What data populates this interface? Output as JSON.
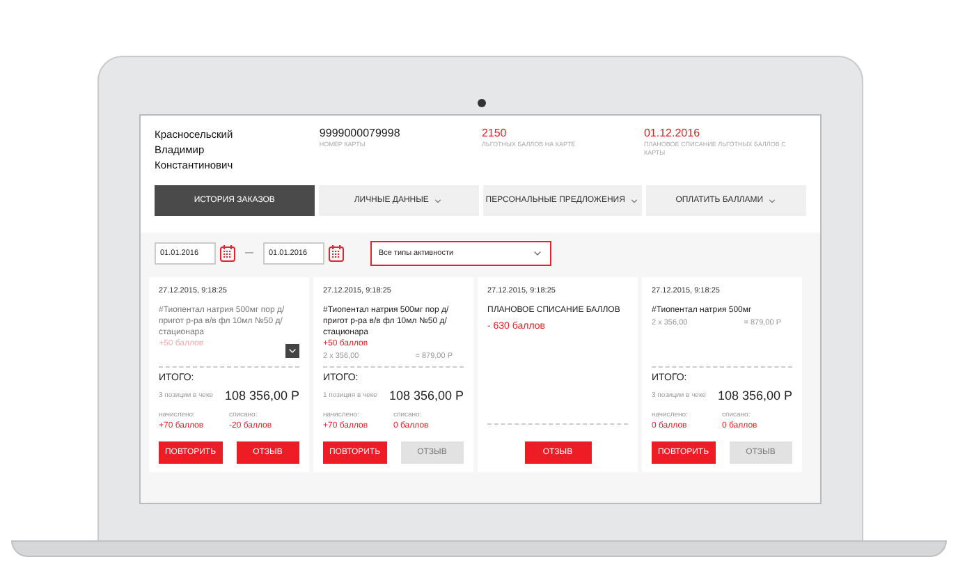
{
  "customer": {
    "name_lines": [
      "Красносельский",
      "Владимир",
      "Константинович"
    ]
  },
  "stats": [
    {
      "value": "9999000079998",
      "label": "НОМЕР КАРТЫ",
      "accent": false
    },
    {
      "value": "2150",
      "label": "ЛЬГОТНЫХ БАЛЛОВ НА КАРТЕ",
      "accent": true
    },
    {
      "value": "01.12.2016",
      "label": "ПЛАНОВОЕ СПИСАНИЕ ЛЬГОТНЫХ БАЛЛОВ С КАРТЫ",
      "accent": true
    }
  ],
  "tabs": [
    {
      "label": "ИСТОРИЯ ЗАКАЗОВ",
      "selected": true,
      "dropdown": false
    },
    {
      "label": "ЛИЧНЫЕ ДАННЫЕ",
      "selected": false,
      "dropdown": true
    },
    {
      "label": "ПЕРСОНАЛЬНЫЕ ПРЕДЛОЖЕНИЯ",
      "selected": false,
      "dropdown": true
    },
    {
      "label": "ОПЛАТИТЬ БАЛЛАМИ",
      "selected": false,
      "dropdown": true
    }
  ],
  "filter": {
    "date_from": "01.01.2016",
    "separator": "—",
    "date_to": "01.01.2016",
    "activity": "Все типы активности"
  },
  "orders": [
    {
      "kind": "order",
      "datetime": "27.12.2015, 9:18:25",
      "collapsed": true,
      "items": [
        {
          "name": "#Тиопентал натрия 500мг пор д/пригот р-ра в/в фл 10мл №50 д/стационара",
          "points": "+50 баллов"
        }
      ],
      "total_label": "ИТОГО:",
      "positions": "3 позиции в чеке",
      "total": "108 356,00 Р",
      "accrued_label": "начислено:",
      "accrued": "+70 баллов",
      "written_label": "списано:",
      "written": "-20 баллов",
      "buttons": [
        {
          "label": "ПОВТОРИТЬ",
          "disabled": false
        },
        {
          "label": "ОТЗЫВ",
          "disabled": false
        }
      ]
    },
    {
      "kind": "order",
      "datetime": "27.12.2015, 9:18:25",
      "collapsed": false,
      "items": [
        {
          "name": "#Тиопентал натрия 500мг пор д/пригот р-ра в/в фл 10мл №50 д/стационара",
          "points": "+50 баллов",
          "qty": "2 х 356,00",
          "sum": "= 879,00 Р"
        }
      ],
      "total_label": "ИТОГО:",
      "positions": "1 позиция в чеке",
      "total": "108 356,00 Р",
      "accrued_label": "начислено:",
      "accrued": "+70 баллов",
      "written_label": "списано:",
      "written": "0 баллов",
      "buttons": [
        {
          "label": "ПОВТОРИТЬ",
          "disabled": false
        },
        {
          "label": "ОТЗЫВ",
          "disabled": true
        }
      ]
    },
    {
      "kind": "writeoff",
      "datetime": "27.12.2015, 9:18:25",
      "title": "ПЛАНОВОЕ СПИСАНИЕ БАЛЛОВ",
      "amount": "- 630 баллов",
      "buttons": [
        {
          "label": "ОТЗЫВ",
          "disabled": false
        }
      ]
    },
    {
      "kind": "order",
      "datetime": "27.12.2015, 9:18:25",
      "collapsed": false,
      "items": [
        {
          "name": "#Тиопентал натрия 500мг",
          "qty": "2 х 356,00",
          "sum": "= 879,00 Р"
        }
      ],
      "total_label": "ИТОГО:",
      "positions": "3 позиции в чеке",
      "total": "108 356,00 Р",
      "accrued_label": "начислено:",
      "accrued": "0 баллов",
      "written_label": "списано:",
      "written": "0 баллов",
      "buttons": [
        {
          "label": "ПОВТОРИТЬ",
          "disabled": false
        },
        {
          "label": "ОТЗЫВ",
          "disabled": true
        }
      ]
    }
  ]
}
